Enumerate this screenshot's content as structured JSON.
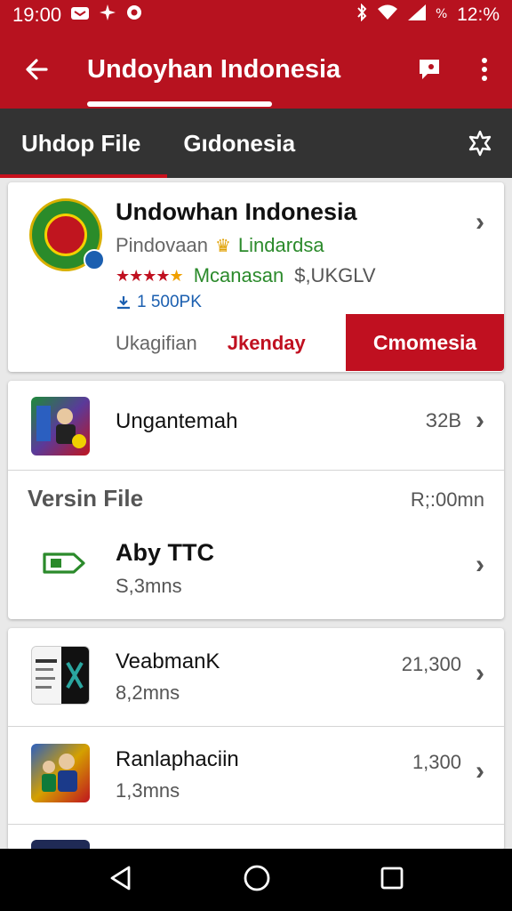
{
  "status_bar": {
    "time": "19:00",
    "battery": "12:%"
  },
  "app_bar": {
    "title": "Undoyhan Indonesia"
  },
  "tabs": [
    {
      "label": "Uhdop File"
    },
    {
      "label": "Gıdonesia"
    }
  ],
  "main_card": {
    "title": "Undowhan Indonesia",
    "subtitle_left": "Pindovaan",
    "subtitle_right": "Lindardsa",
    "rating_stars": 5,
    "developer": "Mcanasan",
    "size": "$,UKGLV",
    "downloads": "1 500PK",
    "action_1": "Ukagifian",
    "action_2": "Jkenday",
    "install_label": "Cmomesia"
  },
  "list_card": {
    "item_1": {
      "title": "Ungantemah",
      "value": "З2В"
    },
    "section_title": "Versin File",
    "section_value": "R;:00mn",
    "item_2": {
      "title": "Aby TTC",
      "sub": "S,3mns"
    }
  },
  "bottom_card": {
    "item_1": {
      "title": "VeabmanK",
      "sub": "8,2mns",
      "value": "21,300"
    },
    "item_2": {
      "title": "Ranlaphaciin",
      "sub": "1,3mns",
      "value": "1,300"
    }
  },
  "colors": {
    "primary": "#b7121f",
    "tab_bar": "#333333",
    "accent_green": "#2b8a2b",
    "link_blue": "#1b5fb0"
  }
}
